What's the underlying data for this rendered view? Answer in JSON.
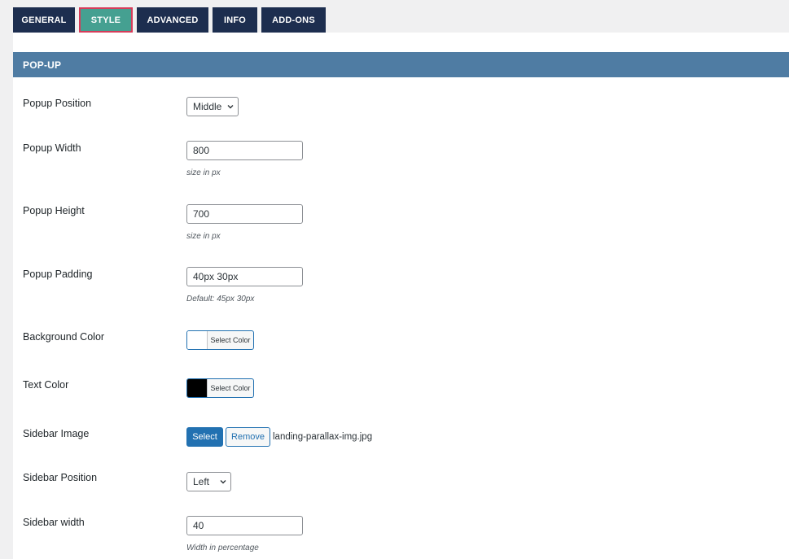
{
  "tabs": [
    {
      "label": "GENERAL",
      "active": false
    },
    {
      "label": "STYLE",
      "active": true
    },
    {
      "label": "ADVANCED",
      "active": false
    },
    {
      "label": "INFO",
      "active": false
    },
    {
      "label": "ADD-ONS",
      "active": false
    }
  ],
  "section": {
    "title": "POP-UP"
  },
  "fields": {
    "popup_position": {
      "label": "Popup Position",
      "value": "Middle"
    },
    "popup_width": {
      "label": "Popup Width",
      "value": "800",
      "hint": "size in px"
    },
    "popup_height": {
      "label": "Popup Height",
      "value": "700",
      "hint": "size in px"
    },
    "popup_padding": {
      "label": "Popup Padding",
      "value": "40px 30px",
      "hint": "Default: 45px 30px"
    },
    "background_color": {
      "label": "Background Color",
      "button_label": "Select Color",
      "color": "#ffffff"
    },
    "text_color": {
      "label": "Text Color",
      "button_label": "Select Color",
      "color": "#000000"
    },
    "sidebar_image": {
      "label": "Sidebar Image",
      "select_label": "Select",
      "remove_label": "Remove",
      "filename": "landing-parallax-img.jpg"
    },
    "sidebar_position": {
      "label": "Sidebar Position",
      "value": "Left"
    },
    "sidebar_width": {
      "label": "Sidebar width",
      "value": "40",
      "hint": "Width in percentage"
    }
  },
  "colors": {
    "tab_bg": "#1d2e4f",
    "tab_active_bg": "#45a091",
    "tab_active_border": "#d63c5a",
    "section_header_bg": "#4f7ca3",
    "primary_button": "#2271b1"
  },
  "icons": {
    "dropdown": "chevron-down-icon"
  }
}
